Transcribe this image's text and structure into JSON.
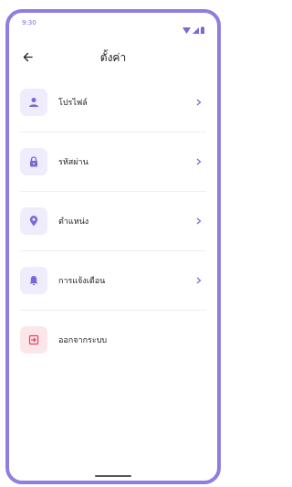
{
  "status": {
    "time": "9:30",
    "icons": [
      "wifi-icon",
      "signal-icon",
      "battery-icon"
    ]
  },
  "header": {
    "title": "ตั้งค่า",
    "back_icon": "arrow-left-icon"
  },
  "menu": {
    "items": [
      {
        "label": "โปรไฟล์",
        "icon": "person-icon",
        "chevron": true
      },
      {
        "label": "รหัสผ่าน",
        "icon": "lock-icon",
        "chevron": true
      },
      {
        "label": "ตำแหน่ง",
        "icon": "location-pin-icon",
        "chevron": true
      },
      {
        "label": "การแจ้งเตือน",
        "icon": "bell-icon",
        "chevron": true
      },
      {
        "label": "ออกจากระบบ",
        "icon": "logout-icon",
        "chevron": false
      }
    ]
  },
  "colors": {
    "accent": "#7b68d8",
    "frame": "#8f7ee0",
    "icon_bg": "#efecfb",
    "danger": "#e6425a",
    "danger_bg": "#fde6ea"
  }
}
